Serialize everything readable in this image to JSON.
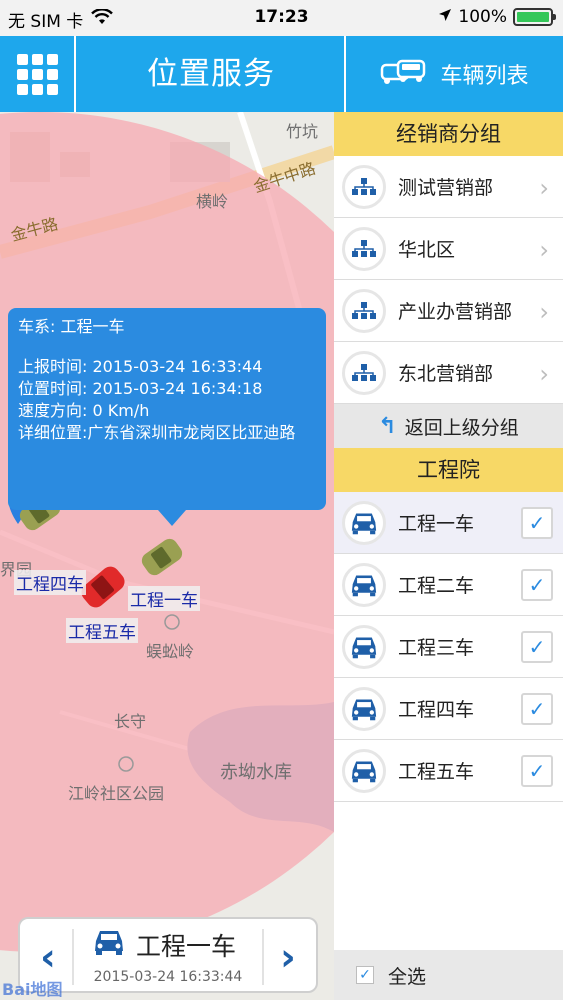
{
  "status_bar": {
    "carrier": "无 SIM 卡",
    "time": "17:23",
    "battery_text": "100%",
    "icons": [
      "wifi-icon",
      "location-arrow-icon",
      "battery-icon"
    ]
  },
  "nav": {
    "title": "位置服务",
    "vehicle_list_label": "车辆列表",
    "menu_icon": "grid-menu-icon",
    "vehicle_icon": "vehicles-icon"
  },
  "map": {
    "labels": {
      "zhukeng": "竹坑",
      "jinniuzhong": "金牛中路",
      "hengling": "横岭",
      "jinniu": "金牛路",
      "jieyuan": "界园",
      "wugongling": "蜈蚣岭",
      "changshou": "长守",
      "chiaoshuiku": "赤坳水库",
      "jianglingpark": "江岭社区公园"
    },
    "car_labels": {
      "car4": "工程四车",
      "car1": "工程一车",
      "car5": "工程五车"
    },
    "popup": {
      "series": "车系: 工程一车",
      "report_time": "上报时间: 2015-03-24 16:33:44",
      "position_time": "位置时间: 2015-03-24 16:34:18",
      "speed": "速度方向: 0 Km/h",
      "address": "详细位置:广东省深圳市龙岗区比亚迪路"
    },
    "bottom_bar": {
      "car_name": "工程一车",
      "time": "2015-03-24 16:33:44",
      "prev": "‹",
      "next": "›"
    },
    "watermark": "Bai地图",
    "colors": {
      "radius_circle": "#f7a9b1",
      "popup": "#2b8be0"
    }
  },
  "panel": {
    "dealer_group_title": "经销商分组",
    "groups": [
      {
        "label": "测试营销部"
      },
      {
        "label": "华北区"
      },
      {
        "label": "产业办营销部"
      },
      {
        "label": "东北营销部"
      }
    ],
    "back_label": "返回上级分组",
    "institute_title": "工程院",
    "vehicles": [
      {
        "label": "工程一车",
        "checked": true
      },
      {
        "label": "工程二车",
        "checked": true
      },
      {
        "label": "工程三车",
        "checked": true
      },
      {
        "label": "工程四车",
        "checked": true
      },
      {
        "label": "工程五车",
        "checked": true
      }
    ],
    "select_all_label": "全选",
    "check_mark": "✓",
    "chevron": "›",
    "back_icon": "↰"
  }
}
